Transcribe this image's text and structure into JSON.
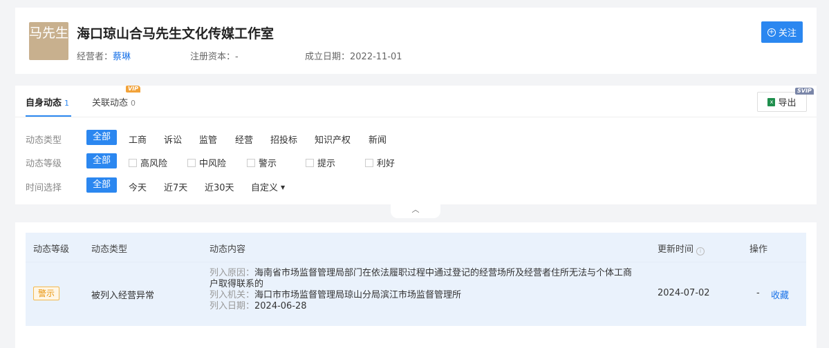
{
  "header": {
    "avatar_text": "马先生",
    "company_name": "海口琼山合马先生文化传媒工作室",
    "operator_label": "经营者：",
    "operator_name": "蔡琳",
    "capital_label": "注册资本：",
    "capital_value": "-",
    "founded_label": "成立日期：",
    "founded_value": "2022-11-01",
    "follow_label": "关注"
  },
  "tabs": [
    {
      "label": "自身动态",
      "count": "1"
    },
    {
      "label": "关联动态",
      "count": "0"
    }
  ],
  "badges": {
    "vip": "VIP",
    "svip": "SVIP"
  },
  "export_label": "导出",
  "filters": {
    "type_label": "动态类型",
    "type_options": [
      "全部",
      "工商",
      "诉讼",
      "监管",
      "经营",
      "招投标",
      "知识产权",
      "新闻"
    ],
    "level_label": "动态等级",
    "level_options": [
      "全部",
      "高风险",
      "中风险",
      "警示",
      "提示",
      "利好"
    ],
    "time_label": "时间选择",
    "time_options": [
      "全部",
      "今天",
      "近7天",
      "近30天",
      "自定义"
    ]
  },
  "table": {
    "columns": [
      "动态等级",
      "动态类型",
      "动态内容",
      "更新时间",
      "操作"
    ],
    "rows": [
      {
        "level": "警示",
        "type": "被列入经营异常",
        "reason_label": "列入原因：",
        "reason_line1": "海南省市场监督管理局部门在依法履职过程中通过登记的经营场所及经营者住所无法与个体工商",
        "reason_line2": "户取得联系的",
        "org_label": "列入机关：",
        "org": "海口市市场监督管理局琼山分局滨江市场监督管理所",
        "date_label": "列入日期：",
        "date": "2024-06-28",
        "updated": "2024-07-02",
        "action_dash": "-",
        "action_fav": "收藏"
      }
    ]
  },
  "colors": {
    "accent": "#2b87f0",
    "warn": "#e8940a",
    "avatar_bg": "#c8b08e"
  }
}
